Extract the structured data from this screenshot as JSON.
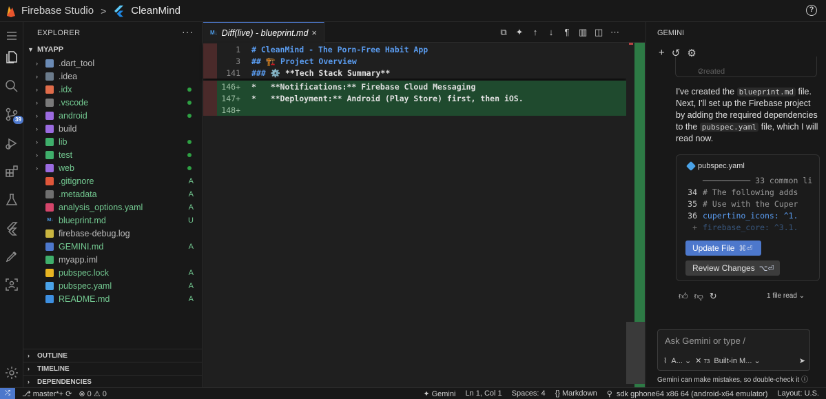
{
  "topbar": {
    "brand": "Firebase Studio",
    "separator": ">",
    "project": "CleanMind",
    "help": "?"
  },
  "activity": {
    "badge": "39"
  },
  "explorer": {
    "title": "EXPLORER",
    "more": "···",
    "root": "MYAPP",
    "items": [
      {
        "name": ".dart_tool",
        "folder": true,
        "color": "gray",
        "status": ""
      },
      {
        "name": ".idea",
        "folder": true,
        "color": "gray",
        "status": ""
      },
      {
        "name": ".idx",
        "folder": true,
        "color": "green",
        "status": "dot"
      },
      {
        "name": ".vscode",
        "folder": true,
        "color": "green",
        "status": "dot"
      },
      {
        "name": "android",
        "folder": true,
        "color": "green",
        "status": "dot"
      },
      {
        "name": "build",
        "folder": true,
        "color": "gray",
        "status": ""
      },
      {
        "name": "lib",
        "folder": true,
        "color": "green",
        "status": "dot"
      },
      {
        "name": "test",
        "folder": true,
        "color": "green",
        "status": "dot"
      },
      {
        "name": "web",
        "folder": true,
        "color": "green",
        "status": "dot"
      },
      {
        "name": ".gitignore",
        "folder": false,
        "color": "green",
        "status": "A"
      },
      {
        "name": ".metadata",
        "folder": false,
        "color": "green",
        "status": "A"
      },
      {
        "name": "analysis_options.yaml",
        "folder": false,
        "color": "green",
        "status": "A"
      },
      {
        "name": "blueprint.md",
        "folder": false,
        "color": "green",
        "status": "U"
      },
      {
        "name": "firebase-debug.log",
        "folder": false,
        "color": "gray",
        "status": ""
      },
      {
        "name": "GEMINI.md",
        "folder": false,
        "color": "green",
        "status": "A"
      },
      {
        "name": "myapp.iml",
        "folder": false,
        "color": "gray",
        "status": ""
      },
      {
        "name": "pubspec.lock",
        "folder": false,
        "color": "green",
        "status": "A"
      },
      {
        "name": "pubspec.yaml",
        "folder": false,
        "color": "green",
        "status": "A"
      },
      {
        "name": "README.md",
        "folder": false,
        "color": "green",
        "status": "A"
      }
    ],
    "sections": [
      "OUTLINE",
      "TIMELINE",
      "DEPENDENCIES"
    ]
  },
  "editor": {
    "tab": {
      "icon": "M↓",
      "label": "Diff(live) - blueprint.md",
      "close": "×"
    },
    "sticky": [
      {
        "num": "1",
        "prefix": "# ",
        "text": "CleanMind - The Porn-Free Habit App"
      },
      {
        "num": "3",
        "prefix": "## ",
        "text": "🏗️ Project Overview"
      },
      {
        "num": "141",
        "prefix": "### ",
        "text": "⚙️ **Tech Stack Summary**"
      }
    ],
    "added": [
      {
        "num": "146+",
        "text": "*   **Notifications:** Firebase Cloud Messaging"
      },
      {
        "num": "147+",
        "text": "*   **Deployment:** Android (Play Store) first, then iOS."
      },
      {
        "num": "148+",
        "text": ""
      }
    ]
  },
  "gemini": {
    "title": "GEMINI",
    "created": "Created",
    "message": {
      "p1": "I've created the ",
      "code1": "blueprint.md",
      "p2": " file. Next, I'll set up the Firebase project by adding the required dependencies to the ",
      "code2": "pubspec.yaml",
      "p3": " file, which I will read now."
    },
    "card": {
      "file": "pubspec.yaml",
      "lines": [
        {
          "n": "",
          "t": "────────── 33 common li"
        },
        {
          "n": "34",
          "t": "# The following adds"
        },
        {
          "n": "35",
          "t": "# Use with the Cuper"
        },
        {
          "n": "36",
          "t": "cupertino_icons: ^1."
        },
        {
          "n": "+",
          "t": "firebase_core: ^3.1."
        }
      ],
      "update": "Update File",
      "update_kbd": "⌘⏎",
      "review": "Review Changes",
      "review_kbd": "⌥⏎"
    },
    "files_read": "1 file read",
    "input_placeholder": "Ask Gemini or type /",
    "mode": "A...",
    "count": "73",
    "model": "Built-in M...",
    "note": "Gemini can make mistakes, so double-check it"
  },
  "status": {
    "branch": "master*+",
    "problems": "0",
    "warnings": "0",
    "gemini": "Gemini",
    "position": "Ln 1, Col 1",
    "spaces": "Spaces: 4",
    "language": "Markdown",
    "device": "sdk gphone64 x86 64 (android-x64 emulator)",
    "layout": "Layout: U.S."
  },
  "colors": {
    "accent": "#4d78cc",
    "added_bg": "#1f4a2e",
    "green_text": "#73c991",
    "heading": "#5a9cf0"
  }
}
